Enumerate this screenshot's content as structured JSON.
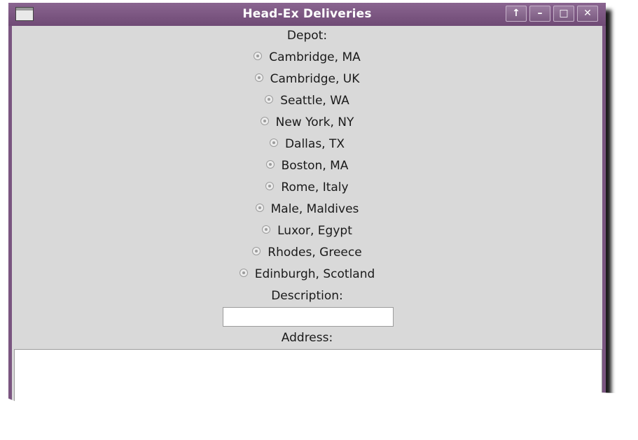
{
  "window": {
    "title": "Head-Ex Deliveries",
    "controls": [
      {
        "name": "shade-button",
        "glyph": "↑"
      },
      {
        "name": "minimize-button",
        "glyph": "–"
      },
      {
        "name": "maximize-button",
        "glyph": "□"
      },
      {
        "name": "close-button",
        "glyph": "✕"
      }
    ]
  },
  "form": {
    "depot_label": "Depot:",
    "depots": [
      "Cambridge, MA",
      "Cambridge, UK",
      "Seattle, WA",
      "New York, NY",
      "Dallas, TX",
      "Boston, MA",
      "Rome, Italy",
      "Male, Maldives",
      "Luxor, Egypt",
      "Rhodes, Greece",
      "Edinburgh, Scotland"
    ],
    "description_label": "Description:",
    "description_value": "",
    "address_label": "Address:",
    "address_value": ""
  },
  "colors": {
    "titlebar": "#7a5580",
    "client_bg": "#d9d9d9"
  }
}
